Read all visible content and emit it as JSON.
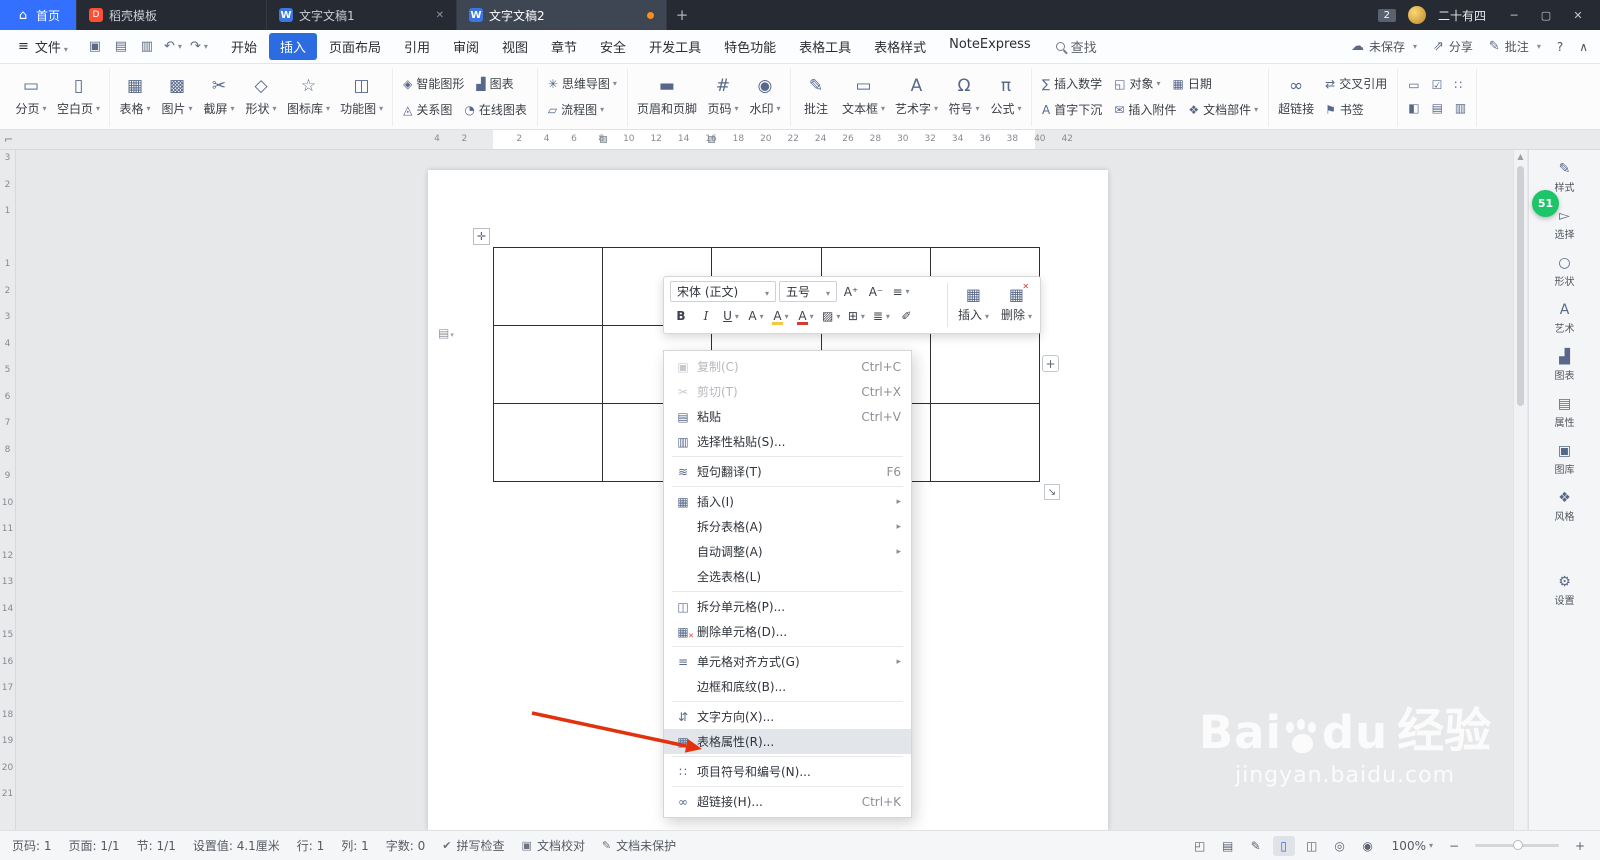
{
  "colors": {
    "accent": "#3370ff",
    "active_menu": "#2d6ce0",
    "arrow": "#e2320d",
    "badge_green": "#1dc468",
    "unsaved_dot": "#ff8d1a",
    "menu_highlight": "#e2e6ea"
  },
  "titlebar": {
    "tabs": [
      {
        "label": "首页",
        "icon": "home-icon",
        "kind": "home"
      },
      {
        "label": "稻壳模板",
        "icon": "docer-icon",
        "kind": "normal"
      },
      {
        "label": "文字文稿1",
        "icon": "wpsdoc-icon",
        "kind": "normal",
        "close": true
      },
      {
        "label": "文字文稿2",
        "icon": "wpsdoc-icon",
        "kind": "active",
        "modified": true
      }
    ],
    "new_tab_label": "+",
    "badge": "2",
    "username": "二十有四",
    "window_buttons": [
      {
        "name": "minimize-button",
        "icon": "minimize-icon"
      },
      {
        "name": "maximize-button",
        "icon": "maximize-icon"
      },
      {
        "name": "close-button",
        "icon": "close-icon"
      }
    ]
  },
  "menubar": {
    "file_label": "文件",
    "quick": [
      {
        "name": "save-button",
        "icon": "save-icon"
      },
      {
        "name": "print-button",
        "icon": "printer-icon"
      },
      {
        "name": "print-preview-button",
        "icon": "preview-icon"
      },
      {
        "name": "undo-button",
        "icon": "undo-icon",
        "dd": true
      },
      {
        "name": "redo-button",
        "icon": "redo-icon",
        "dd": true
      }
    ],
    "menus": [
      {
        "label": "开始"
      },
      {
        "label": "插入",
        "active": true
      },
      {
        "label": "页面布局"
      },
      {
        "label": "引用"
      },
      {
        "label": "审阅"
      },
      {
        "label": "视图"
      },
      {
        "label": "章节"
      },
      {
        "label": "安全"
      },
      {
        "label": "开发工具"
      },
      {
        "label": "特色功能"
      },
      {
        "label": "表格工具"
      },
      {
        "label": "表格样式"
      },
      {
        "label": "NoteExpress"
      }
    ],
    "search_label": "查找",
    "right": [
      {
        "name": "save-status",
        "label": "未保存",
        "icon": "cloud-icon",
        "dd": true
      },
      {
        "name": "share-button",
        "label": "分享",
        "icon": "share-icon"
      },
      {
        "name": "comment-button",
        "label": "批注",
        "icon": "comment-icon",
        "dd": true
      }
    ],
    "help_label": "?",
    "collapse_icon": "collapse-icon"
  },
  "ribbon": {
    "groups": [
      {
        "large": [
          {
            "label": "分页",
            "icon": "pagebreak-icon",
            "dd": true
          },
          {
            "label": "空白页",
            "icon": "blankpage-icon",
            "dd": true
          }
        ]
      },
      {
        "large": [
          {
            "label": "表格",
            "icon": "table-icon",
            "dd": true
          },
          {
            "label": "图片",
            "icon": "picture-icon",
            "dd": true
          },
          {
            "label": "截屏",
            "icon": "screenshot-icon",
            "dd": true
          },
          {
            "label": "形状",
            "icon": "shapes-icon",
            "dd": true
          },
          {
            "label": "图标库",
            "icon": "iconlib-icon",
            "dd": true
          },
          {
            "label": "功能图",
            "icon": "funcdiag-icon",
            "dd": true
          }
        ]
      },
      {
        "rows": [
          [
            {
              "label": "智能图形",
              "icon": "smartart-icon"
            },
            {
              "label": "图表",
              "icon": "chart-icon"
            }
          ],
          [
            {
              "label": "关系图",
              "icon": "relation-icon"
            },
            {
              "label": "在线图表",
              "icon": "onlinechart-icon"
            }
          ]
        ]
      },
      {
        "rows": [
          [
            {
              "label": "思维导图",
              "icon": "mindmap-icon",
              "dd": true
            }
          ],
          [
            {
              "label": "流程图",
              "icon": "flowchart-icon",
              "dd": true
            }
          ]
        ]
      },
      {
        "large": [
          {
            "label": "页眉和页脚",
            "icon": "headerfooter-icon"
          },
          {
            "label": "页码",
            "icon": "pagenum-icon",
            "dd": true
          },
          {
            "label": "水印",
            "icon": "watermark-icon",
            "dd": true
          }
        ]
      },
      {
        "large": [
          {
            "label": "批注",
            "icon": "comment-icon"
          },
          {
            "label": "文本框",
            "icon": "textbox-icon",
            "dd": true
          },
          {
            "label": "艺术字",
            "icon": "wordart-icon",
            "dd": true
          },
          {
            "label": "符号",
            "icon": "symbol-icon",
            "dd": true
          },
          {
            "label": "公式",
            "icon": "formula-icon",
            "dd": true
          }
        ]
      },
      {
        "rows": [
          [
            {
              "label": "插入数学",
              "icon": "math-icon"
            },
            {
              "label": "对象",
              "icon": "object-icon",
              "dd": true
            },
            {
              "label": "日期",
              "icon": "date-icon"
            }
          ],
          [
            {
              "label": "首字下沉",
              "icon": "dropcap-icon"
            },
            {
              "label": "插入附件",
              "icon": "attach-icon"
            },
            {
              "label": "文档部件",
              "icon": "docpart-icon",
              "dd": true
            }
          ]
        ]
      },
      {
        "large": [
          {
            "label": "超链接",
            "icon": "link-icon"
          }
        ],
        "rows": [
          [
            {
              "label": "交叉引用",
              "icon": "crossref-icon"
            }
          ],
          [
            {
              "label": "书签",
              "icon": "bookmark-icon"
            }
          ]
        ]
      },
      {
        "rows": [
          [
            {
              "icon": "ctrl1-icon"
            },
            {
              "icon": "ctrl2-icon"
            },
            {
              "icon": "ctrl3-icon"
            }
          ],
          [
            {
              "icon": "ctrl4-icon"
            },
            {
              "icon": "ctrl5-icon"
            },
            {
              "icon": "ctrl6-icon"
            }
          ]
        ]
      }
    ]
  },
  "hruler": {
    "numbers": [
      "4",
      "2",
      "",
      "2",
      "4",
      "6",
      "8",
      "10",
      "12",
      "14",
      "16",
      "18",
      "20",
      "22",
      "24",
      "26",
      "28",
      "30",
      "32",
      "34",
      "36",
      "38",
      "40",
      "42"
    ]
  },
  "vruler": {
    "numbers": [
      "3",
      "2",
      "1",
      "",
      "1",
      "2",
      "3",
      "4",
      "5",
      "6",
      "7",
      "8",
      "9",
      "10",
      "11",
      "12",
      "13",
      "14",
      "15",
      "16",
      "17",
      "18",
      "19",
      "20",
      "21"
    ]
  },
  "document": {
    "table": {
      "rows": 3,
      "cols": 5
    }
  },
  "mini_toolbar": {
    "font_name": "宋体 (正文)",
    "font_size": "五号",
    "row1": [
      {
        "name": "increase-font-button",
        "icon": "fontup-icon"
      },
      {
        "name": "decrease-font-button",
        "icon": "fontdown-icon"
      },
      {
        "name": "line-spacing-button",
        "icon": "linespacing-icon",
        "dd": true
      }
    ],
    "row2": [
      {
        "name": "bold-button",
        "icon": "bold-icon"
      },
      {
        "name": "italic-button",
        "icon": "italic-icon"
      },
      {
        "name": "underline-button",
        "icon": "underline-icon",
        "dd": true
      },
      {
        "name": "char-shading-button",
        "icon": "charshade-icon",
        "dd": true
      },
      {
        "name": "highlight-button",
        "icon": "highlight-icon",
        "dd": true
      },
      {
        "name": "font-color-button",
        "icon": "fontcolor-icon",
        "dd": true
      },
      {
        "name": "cell-shading-button",
        "icon": "shade-icon",
        "dd": true
      },
      {
        "name": "border-button",
        "icon": "border-icon",
        "dd": true
      },
      {
        "name": "align-button",
        "icon": "align-icon",
        "dd": true
      },
      {
        "name": "format-painter-button",
        "icon": "painter-icon"
      }
    ],
    "insert_label": "插入",
    "delete_label": "删除"
  },
  "context_menu": {
    "items": [
      {
        "name": "copy",
        "icon": "copy-icon",
        "label": "复制(C)",
        "shortcut": "Ctrl+C",
        "disabled": true
      },
      {
        "name": "cut",
        "icon": "cut-icon",
        "label": "剪切(T)",
        "shortcut": "Ctrl+X",
        "disabled": true
      },
      {
        "name": "paste",
        "icon": "paste-icon",
        "label": "粘贴",
        "shortcut": "Ctrl+V"
      },
      {
        "name": "paste-special",
        "icon": "pastespecial-icon",
        "label": "选择性粘贴(S)..."
      },
      {
        "sep": true
      },
      {
        "name": "translate",
        "icon": "translate-icon",
        "label": "短句翻译(T)",
        "shortcut": "F6"
      },
      {
        "sep": true
      },
      {
        "name": "insert",
        "icon": "insert-icon",
        "label": "插入(I)",
        "submenu": true
      },
      {
        "name": "split-table",
        "label": "拆分表格(A)",
        "submenu": true
      },
      {
        "name": "autofit",
        "label": "自动调整(A)",
        "submenu": true
      },
      {
        "name": "select-table",
        "label": "全选表格(L)"
      },
      {
        "sep": true
      },
      {
        "name": "split-cells",
        "icon": "splitcells-icon",
        "label": "拆分单元格(P)..."
      },
      {
        "name": "delete-cells",
        "icon": "delcells-icon",
        "label": "删除单元格(D)..."
      },
      {
        "sep": true
      },
      {
        "name": "cell-alignment",
        "icon": "cellalign-icon",
        "label": "单元格对齐方式(G)",
        "submenu": true
      },
      {
        "name": "borders-shading",
        "label": "边框和底纹(B)..."
      },
      {
        "sep": true
      },
      {
        "name": "text-direction",
        "icon": "textdir-icon",
        "label": "文字方向(X)..."
      },
      {
        "name": "table-properties",
        "icon": "tableprop-icon",
        "label": "表格属性(R)...",
        "highlighted": true
      },
      {
        "sep": true
      },
      {
        "name": "bullets-numbering",
        "icon": "bullets-icon",
        "label": "项目符号和编号(N)..."
      },
      {
        "sep": true
      },
      {
        "name": "hyperlink",
        "icon": "link2-icon",
        "label": "超链接(H)...",
        "shortcut": "Ctrl+K"
      }
    ]
  },
  "sidebar": {
    "badge": "51",
    "items": [
      {
        "icon": "style-icon",
        "label": "样式"
      },
      {
        "icon": "select-icon",
        "label": "选择"
      },
      {
        "icon": "shape-icon",
        "label": "形状"
      },
      {
        "icon": "art-icon",
        "label": "艺术"
      },
      {
        "icon": "chart2-icon",
        "label": "图表"
      },
      {
        "icon": "prop-icon",
        "label": "属性"
      },
      {
        "icon": "gallery-icon",
        "label": "图库"
      },
      {
        "icon": "stylefeel-icon",
        "label": "风格"
      }
    ],
    "bottom": [
      {
        "icon": "settings-icon",
        "label": "设置"
      }
    ]
  },
  "statusbar": {
    "left": [
      {
        "text": "页码: 1"
      },
      {
        "text": "页面: 1/1"
      },
      {
        "text": "节: 1/1"
      },
      {
        "text": "设置值: 4.1厘米"
      },
      {
        "text": "行: 1"
      },
      {
        "text": "列: 1"
      },
      {
        "text": "字数: 0"
      },
      {
        "icon": "spell-icon",
        "text": "拼写检查"
      },
      {
        "icon": "proofread-icon",
        "text": "文档校对"
      },
      {
        "icon": "protect-icon",
        "text": "文档未保护"
      }
    ],
    "right_icons": [
      {
        "name": "fullscreen-icon"
      },
      {
        "name": "readmode-icon"
      },
      {
        "name": "ink-icon"
      },
      {
        "name": "pageview-icon",
        "active": true
      },
      {
        "name": "multipage-icon"
      },
      {
        "name": "webview-icon"
      },
      {
        "name": "eye-icon"
      }
    ],
    "zoom": {
      "value": "100%"
    }
  },
  "watermark": {
    "brand_a": "Bai",
    "brand_b": "du",
    "brand_cn": "经验",
    "url": "jingyan.baidu.com"
  }
}
